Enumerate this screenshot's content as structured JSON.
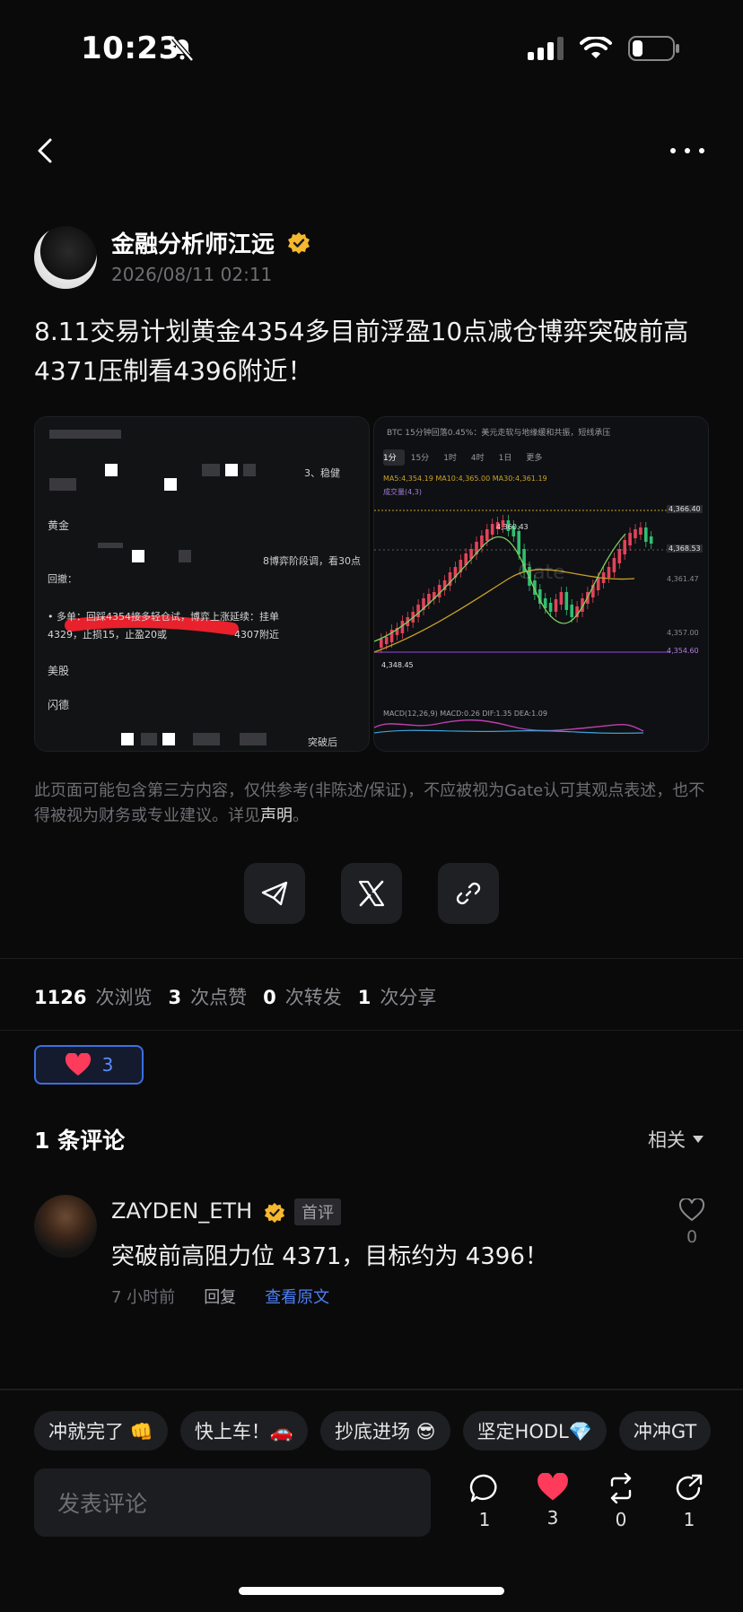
{
  "status": {
    "time": "10:23"
  },
  "author": {
    "name": "金融分析师江远",
    "time": "2026/08/11 02:11"
  },
  "post": {
    "text": "8.11交易计划黄金4354多目前浮盈10点减仓博弈突破前高4371压制看4396附近！"
  },
  "images": {
    "left": {
      "lines": [
        "黄金",
        "回撤：",
        "• 多单：回踩4354接多轻仓试，博弈上涨延续：挂单",
        "4329，止损15，止盈20或",
        "4307附近",
        "美股",
        "闪德"
      ],
      "fragments": [
        "3、稳健",
        "8博弈阶段调，看30点",
        "突破后"
      ]
    },
    "right": {
      "header": "BTC 15分钟回落0.45%：美元走软与地缘缓和共振，短线承压",
      "tabs": [
        "1分",
        "15分",
        "1时",
        "4时",
        "1日",
        "更多"
      ],
      "ma_line": "MA5:4,354.19  MA10:4,365.00  MA30:4,361.19",
      "sub_line": "成交量(4,3)",
      "labels": [
        "4,360.43",
        "4,366.40",
        "4,368.53",
        "4,361.47",
        "4,357.00",
        "4,354.60",
        "4,348.45"
      ],
      "macd": "MACD(12,26,9)  MACD:0.26  DIF:1.35  DEA:1.09",
      "watermark": "Gate"
    }
  },
  "disclaimer": {
    "text": "此页面可能包含第三方内容，仅供参考(非陈述/保证)，不应被视为Gate认可其观点表述，也不得被视为财务或专业建议。详见",
    "link": "声明",
    "end": "。"
  },
  "stats": {
    "views": "1126",
    "views_label": "次浏览",
    "likes": "3",
    "likes_label": "次点赞",
    "reposts": "0",
    "reposts_label": "次转发",
    "shares": "1",
    "shares_label": "次分享"
  },
  "reaction": {
    "count": "3"
  },
  "comments": {
    "title": "1 条评论",
    "sort": "相关",
    "items": [
      {
        "name": "ZAYDEN_ETH",
        "badge": "首评",
        "text": "突破前高阻力位 4371，目标约为 4396！",
        "time": "7 小时前",
        "reply": "回复",
        "original": "查看原文",
        "likes": "0"
      }
    ]
  },
  "quick_replies": [
    "冲就完了 👊",
    "快上车！🚗",
    "抄底进场 😎",
    "坚定HODL💎",
    "冲冲GT"
  ],
  "composer": {
    "placeholder": "发表评论"
  },
  "actions": {
    "comment": "1",
    "like": "3",
    "repost": "0",
    "share": "1"
  },
  "colors": {
    "accent": "#4f7ff2",
    "like": "#ff3b5c",
    "verified": "#f5b82e"
  }
}
